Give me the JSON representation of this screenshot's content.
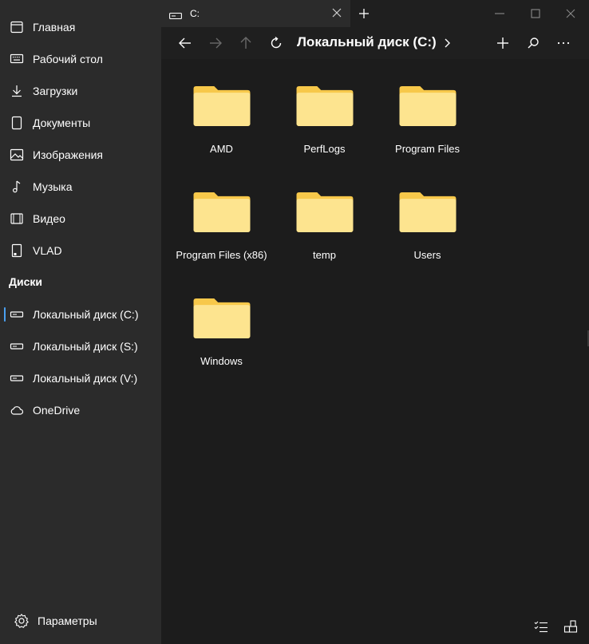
{
  "sidebar": {
    "items": [
      {
        "label": "Главная",
        "icon": "home-icon"
      },
      {
        "label": "Рабочий стол",
        "icon": "desktop-icon"
      },
      {
        "label": "Загрузки",
        "icon": "download-icon"
      },
      {
        "label": "Документы",
        "icon": "document-icon"
      },
      {
        "label": "Изображения",
        "icon": "pictures-icon"
      },
      {
        "label": "Музыка",
        "icon": "music-icon"
      },
      {
        "label": "Видео",
        "icon": "video-icon"
      },
      {
        "label": "VLAD",
        "icon": "user-folder-icon"
      }
    ],
    "section_header": "Диски",
    "drives": [
      {
        "label": "Локальный диск (C:)",
        "icon": "drive-icon",
        "active": true
      },
      {
        "label": "Локальный диск (S:)",
        "icon": "drive-icon"
      },
      {
        "label": "Локальный диск (V:)",
        "icon": "drive-icon"
      }
    ],
    "cloud": {
      "label": "OneDrive",
      "icon": "cloud-icon"
    },
    "settings_label": "Параметры"
  },
  "tab": {
    "label": "C:"
  },
  "toolbar": {
    "breadcrumb": "Локальный диск (C:)"
  },
  "folders": [
    {
      "name": "AMD"
    },
    {
      "name": "PerfLogs"
    },
    {
      "name": "Program Files"
    },
    {
      "name": "Program Files (x86)"
    },
    {
      "name": "temp"
    },
    {
      "name": "Users"
    },
    {
      "name": "Windows"
    }
  ],
  "colors": {
    "accent": "#4aa0f0",
    "folder_body": "#fde48f",
    "folder_tab": "#f7c84a"
  }
}
